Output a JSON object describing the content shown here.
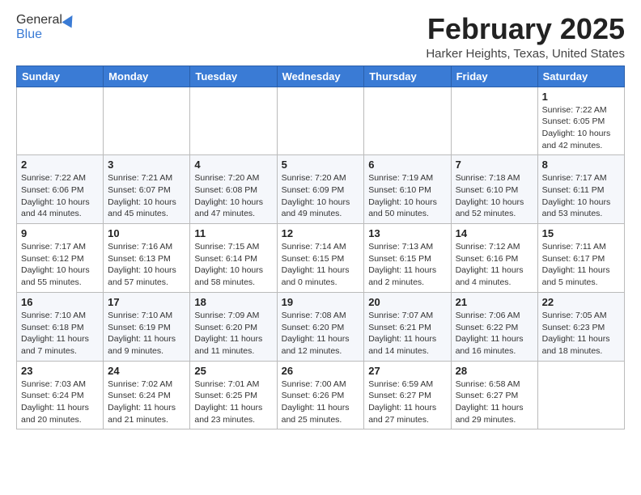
{
  "header": {
    "logo_general": "General",
    "logo_blue": "Blue",
    "title": "February 2025",
    "subtitle": "Harker Heights, Texas, United States"
  },
  "weekdays": [
    "Sunday",
    "Monday",
    "Tuesday",
    "Wednesday",
    "Thursday",
    "Friday",
    "Saturday"
  ],
  "weeks": [
    [
      {
        "day": "",
        "detail": ""
      },
      {
        "day": "",
        "detail": ""
      },
      {
        "day": "",
        "detail": ""
      },
      {
        "day": "",
        "detail": ""
      },
      {
        "day": "",
        "detail": ""
      },
      {
        "day": "",
        "detail": ""
      },
      {
        "day": "1",
        "detail": "Sunrise: 7:22 AM\nSunset: 6:05 PM\nDaylight: 10 hours\nand 42 minutes."
      }
    ],
    [
      {
        "day": "2",
        "detail": "Sunrise: 7:22 AM\nSunset: 6:06 PM\nDaylight: 10 hours\nand 44 minutes."
      },
      {
        "day": "3",
        "detail": "Sunrise: 7:21 AM\nSunset: 6:07 PM\nDaylight: 10 hours\nand 45 minutes."
      },
      {
        "day": "4",
        "detail": "Sunrise: 7:20 AM\nSunset: 6:08 PM\nDaylight: 10 hours\nand 47 minutes."
      },
      {
        "day": "5",
        "detail": "Sunrise: 7:20 AM\nSunset: 6:09 PM\nDaylight: 10 hours\nand 49 minutes."
      },
      {
        "day": "6",
        "detail": "Sunrise: 7:19 AM\nSunset: 6:10 PM\nDaylight: 10 hours\nand 50 minutes."
      },
      {
        "day": "7",
        "detail": "Sunrise: 7:18 AM\nSunset: 6:10 PM\nDaylight: 10 hours\nand 52 minutes."
      },
      {
        "day": "8",
        "detail": "Sunrise: 7:17 AM\nSunset: 6:11 PM\nDaylight: 10 hours\nand 53 minutes."
      }
    ],
    [
      {
        "day": "9",
        "detail": "Sunrise: 7:17 AM\nSunset: 6:12 PM\nDaylight: 10 hours\nand 55 minutes."
      },
      {
        "day": "10",
        "detail": "Sunrise: 7:16 AM\nSunset: 6:13 PM\nDaylight: 10 hours\nand 57 minutes."
      },
      {
        "day": "11",
        "detail": "Sunrise: 7:15 AM\nSunset: 6:14 PM\nDaylight: 10 hours\nand 58 minutes."
      },
      {
        "day": "12",
        "detail": "Sunrise: 7:14 AM\nSunset: 6:15 PM\nDaylight: 11 hours\nand 0 minutes."
      },
      {
        "day": "13",
        "detail": "Sunrise: 7:13 AM\nSunset: 6:15 PM\nDaylight: 11 hours\nand 2 minutes."
      },
      {
        "day": "14",
        "detail": "Sunrise: 7:12 AM\nSunset: 6:16 PM\nDaylight: 11 hours\nand 4 minutes."
      },
      {
        "day": "15",
        "detail": "Sunrise: 7:11 AM\nSunset: 6:17 PM\nDaylight: 11 hours\nand 5 minutes."
      }
    ],
    [
      {
        "day": "16",
        "detail": "Sunrise: 7:10 AM\nSunset: 6:18 PM\nDaylight: 11 hours\nand 7 minutes."
      },
      {
        "day": "17",
        "detail": "Sunrise: 7:10 AM\nSunset: 6:19 PM\nDaylight: 11 hours\nand 9 minutes."
      },
      {
        "day": "18",
        "detail": "Sunrise: 7:09 AM\nSunset: 6:20 PM\nDaylight: 11 hours\nand 11 minutes."
      },
      {
        "day": "19",
        "detail": "Sunrise: 7:08 AM\nSunset: 6:20 PM\nDaylight: 11 hours\nand 12 minutes."
      },
      {
        "day": "20",
        "detail": "Sunrise: 7:07 AM\nSunset: 6:21 PM\nDaylight: 11 hours\nand 14 minutes."
      },
      {
        "day": "21",
        "detail": "Sunrise: 7:06 AM\nSunset: 6:22 PM\nDaylight: 11 hours\nand 16 minutes."
      },
      {
        "day": "22",
        "detail": "Sunrise: 7:05 AM\nSunset: 6:23 PM\nDaylight: 11 hours\nand 18 minutes."
      }
    ],
    [
      {
        "day": "23",
        "detail": "Sunrise: 7:03 AM\nSunset: 6:24 PM\nDaylight: 11 hours\nand 20 minutes."
      },
      {
        "day": "24",
        "detail": "Sunrise: 7:02 AM\nSunset: 6:24 PM\nDaylight: 11 hours\nand 21 minutes."
      },
      {
        "day": "25",
        "detail": "Sunrise: 7:01 AM\nSunset: 6:25 PM\nDaylight: 11 hours\nand 23 minutes."
      },
      {
        "day": "26",
        "detail": "Sunrise: 7:00 AM\nSunset: 6:26 PM\nDaylight: 11 hours\nand 25 minutes."
      },
      {
        "day": "27",
        "detail": "Sunrise: 6:59 AM\nSunset: 6:27 PM\nDaylight: 11 hours\nand 27 minutes."
      },
      {
        "day": "28",
        "detail": "Sunrise: 6:58 AM\nSunset: 6:27 PM\nDaylight: 11 hours\nand 29 minutes."
      },
      {
        "day": "",
        "detail": ""
      }
    ]
  ]
}
